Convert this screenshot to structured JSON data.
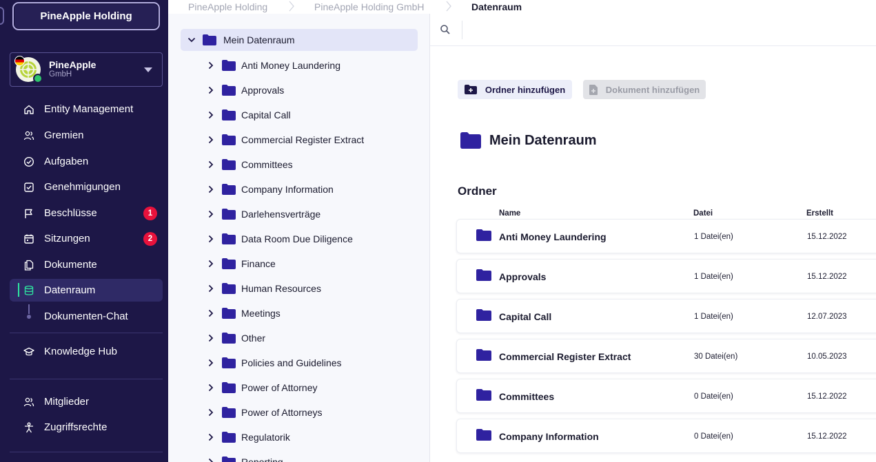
{
  "sidebar": {
    "company_button": "PineApple Holding",
    "entity": {
      "name": "PineApple",
      "subtitle": "GmbH"
    },
    "nav": [
      {
        "label": "Entity Management",
        "icon": "home-icon"
      },
      {
        "label": "Gremien",
        "icon": "people-icon"
      },
      {
        "label": "Aufgaben",
        "icon": "check-circle-icon"
      },
      {
        "label": "Genehmigungen",
        "icon": "check-square-icon"
      },
      {
        "label": "Beschlüsse",
        "icon": "flag-icon",
        "badge": "1"
      },
      {
        "label": "Sitzungen",
        "icon": "calendar-icon",
        "badge": "2"
      },
      {
        "label": "Dokumente",
        "icon": "documents-icon"
      },
      {
        "label": "Datenraum",
        "icon": "database-icon",
        "active": true
      },
      {
        "label": "Dokumenten-Chat",
        "icon": "sub-item"
      },
      {
        "label": "Knowledge Hub",
        "icon": "graduation-cap-icon"
      },
      {
        "label": "Mitglieder",
        "icon": "people-icon"
      },
      {
        "label": "Zugriffsrechte",
        "icon": "access-icon"
      }
    ]
  },
  "breadcrumb": [
    "PineApple Holding",
    "PineApple Holding GmbH",
    "Datenraum"
  ],
  "tree": {
    "root": "Mein Datenraum",
    "items": [
      "Anti Money Laundering",
      "Approvals",
      "Capital Call",
      "Commercial Register Extract",
      "Committees",
      "Company Information",
      "Darlehensverträge",
      "Data Room Due Diligence",
      "Finance",
      "Human Resources",
      "Meetings",
      "Other",
      "Policies and Guidelines",
      "Power of Attorney",
      "Power of Attorneys",
      "Regulatorik",
      "Reporting"
    ]
  },
  "main": {
    "add_folder_label": "Ordner hinzufügen",
    "add_document_label": "Dokument hinzufügen",
    "title": "Mein Datenraum",
    "section_heading": "Ordner",
    "columns": [
      "Name",
      "Datei",
      "Erstellt"
    ],
    "rows": [
      {
        "name": "Anti Money Laundering",
        "files": "1 Datei(en)",
        "created": "15.12.2022"
      },
      {
        "name": "Approvals",
        "files": "1 Datei(en)",
        "created": "15.12.2022"
      },
      {
        "name": "Capital Call",
        "files": "1 Datei(en)",
        "created": "12.07.2023"
      },
      {
        "name": "Commercial Register Extract",
        "files": "30 Datei(en)",
        "created": "10.05.2023"
      },
      {
        "name": "Committees",
        "files": "0 Datei(en)",
        "created": "15.12.2022"
      },
      {
        "name": "Company Information",
        "files": "0 Datei(en)",
        "created": "15.12.2022"
      }
    ]
  },
  "colors": {
    "sidebar_bg": "#1d1747",
    "folder": "#2f22a0",
    "active_accent": "#2ee6a0",
    "badge": "#e8123c"
  }
}
